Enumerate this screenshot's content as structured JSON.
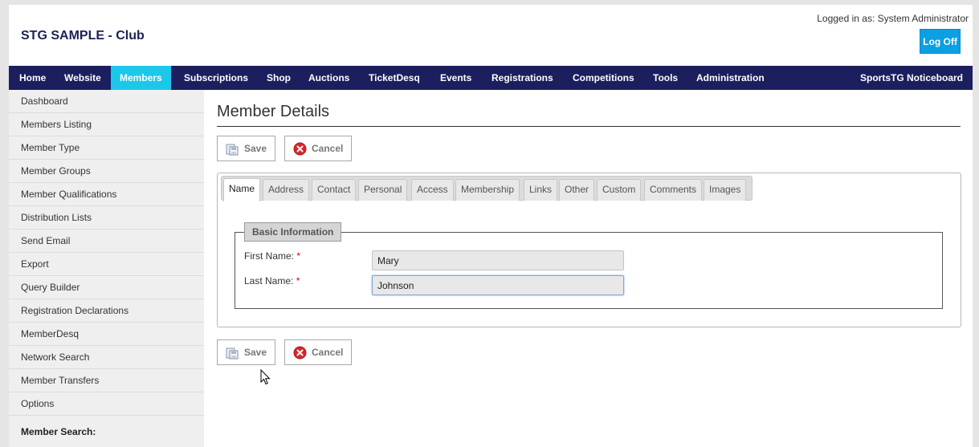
{
  "header": {
    "title": "STG SAMPLE - Club",
    "logged_in": "Logged in as: System Administrator",
    "logoff_label": "Log Off"
  },
  "topnav": {
    "items": [
      "Home",
      "Website",
      "Members",
      "Subscriptions",
      "Shop",
      "Auctions",
      "TicketDesq",
      "Events",
      "Registrations",
      "Competitions",
      "Tools",
      "Administration"
    ],
    "active": "Members",
    "right_item": "SportsTG Noticeboard"
  },
  "sidebar": {
    "items": [
      "Dashboard",
      "Members Listing",
      "Member Type",
      "Member Groups",
      "Member Qualifications",
      "Distribution Lists",
      "Send Email",
      "Export",
      "Query Builder",
      "Registration Declarations",
      "MemberDesq",
      "Network Search",
      "Member Transfers",
      "Options"
    ],
    "search_label": "Member Search:"
  },
  "main": {
    "title": "Member Details",
    "save_label": "Save",
    "cancel_label": "Cancel",
    "tabs": [
      "Name",
      "Address",
      "Contact",
      "Personal",
      "Access",
      "Membership",
      "Links",
      "Other",
      "Custom",
      "Comments",
      "Images"
    ],
    "active_tab": "Name",
    "fieldset": {
      "legend": "Basic Information",
      "first_name_label": "First Name:",
      "last_name_label": "Last Name:",
      "required_mark": "*",
      "first_name_value": "Mary",
      "last_name_value": "Johnson"
    }
  },
  "colors": {
    "nav_bg": "#1b1f5e",
    "nav_active": "#1cc8ea",
    "logoff_bg": "#0b9fe3",
    "cancel_icon": "#d9262a"
  },
  "icons": {
    "save": "save-icon",
    "cancel": "cancel-icon",
    "cursor": "mouse-pointer-icon"
  }
}
